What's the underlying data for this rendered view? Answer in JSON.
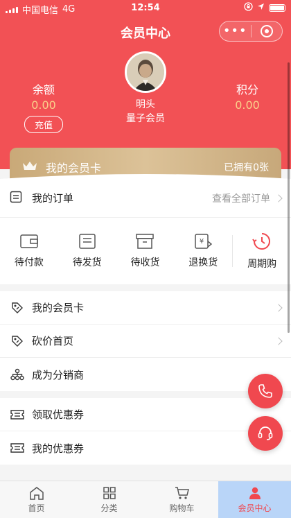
{
  "status_bar": {
    "carrier": "中国电信",
    "network": "4G",
    "time": "12:54"
  },
  "header": {
    "title": "会员中心"
  },
  "stats": {
    "balance_label": "余额",
    "balance_value": "0.00",
    "recharge_label": "充值",
    "points_label": "积分",
    "points_value": "0.00"
  },
  "profile": {
    "name": "明头",
    "level": "量子会员"
  },
  "member_card": {
    "label": "我的会员卡",
    "owned": "已拥有0张"
  },
  "orders": {
    "title": "我的订单",
    "view_all": "查看全部订单",
    "items": [
      {
        "label": "待付款",
        "icon": "wallet-icon"
      },
      {
        "label": "待发货",
        "icon": "box-icon"
      },
      {
        "label": "待收货",
        "icon": "package-icon"
      },
      {
        "label": "退换货",
        "icon": "refund-icon"
      },
      {
        "label": "周期购",
        "icon": "clock-icon"
      }
    ]
  },
  "menu": {
    "group1": [
      {
        "label": "我的会员卡",
        "icon": "tag-icon"
      },
      {
        "label": "砍价首页",
        "icon": "tag-icon"
      },
      {
        "label": "成为分销商",
        "icon": "network-icon"
      }
    ],
    "group2": [
      {
        "label": "领取优惠券",
        "icon": "ticket-icon"
      },
      {
        "label": "我的优惠券",
        "icon": "ticket-icon"
      }
    ]
  },
  "tabbar": {
    "items": [
      {
        "label": "首页",
        "icon": "home-icon"
      },
      {
        "label": "分类",
        "icon": "grid-icon"
      },
      {
        "label": "购物车",
        "icon": "cart-icon"
      },
      {
        "label": "会员中心",
        "icon": "person-icon"
      }
    ],
    "active_index": 3
  },
  "colors": {
    "brand": "#f25155",
    "gold": "#c9a978",
    "accent": "#f0484f",
    "active_tab_bg": "#b9d5f8"
  }
}
